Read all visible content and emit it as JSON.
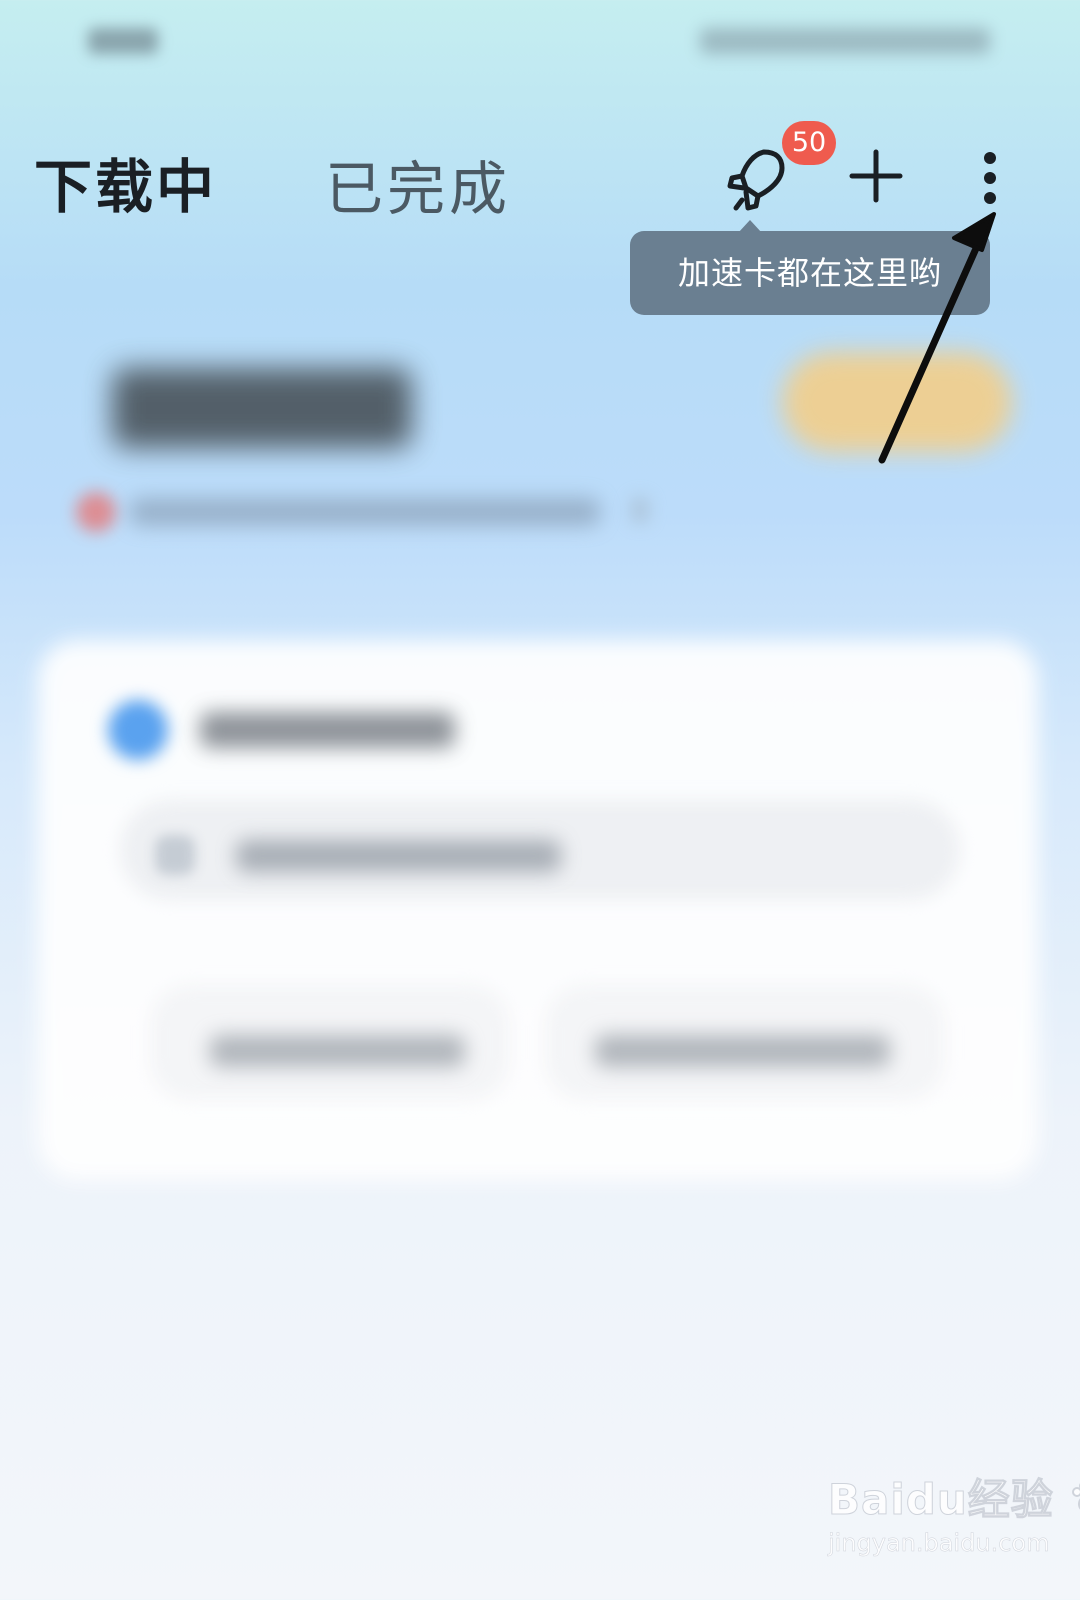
{
  "tabs": [
    {
      "label": "下载中",
      "active": true
    },
    {
      "label": "已完成",
      "active": false
    }
  ],
  "header": {
    "badge_count": "50",
    "icons": [
      "rocket-icon",
      "plus-icon",
      "more-vertical-icon"
    ]
  },
  "tooltip": {
    "text": "加速卡都在这里哟"
  },
  "watermark": {
    "logo": "Baidu经验",
    "url": "jingyan.baidu.com"
  },
  "colors": {
    "badge": "#ef5b4e",
    "tooltip_bg": "#6a7f91",
    "active_tab": "#1a1f24",
    "inactive_tab": "#4b5963",
    "card_accent": "#5aa2ef",
    "hero_button": "#f0cf8f"
  }
}
